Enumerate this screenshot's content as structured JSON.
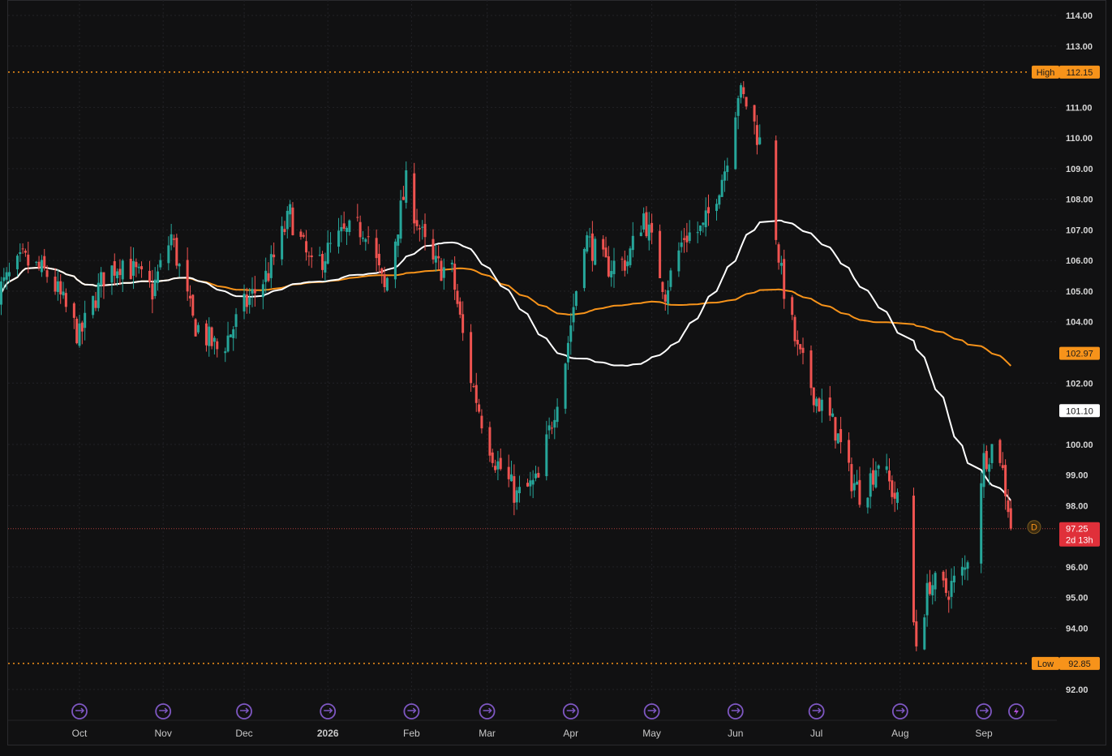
{
  "chart_data": {
    "type": "candlestick",
    "ylim": [
      91.6,
      114.2
    ],
    "y_ticks": [
      "114.00",
      "113.00",
      "111.00",
      "110.00",
      "109.00",
      "108.00",
      "107.00",
      "106.00",
      "105.00",
      "104.00",
      "102.00",
      "100.00",
      "99.00",
      "98.00",
      "96.00",
      "95.00",
      "94.00",
      "92.00"
    ],
    "x_labels": [
      {
        "label": "Oct",
        "date": "2025-10-01",
        "bold": false
      },
      {
        "label": "Nov",
        "date": "2025-11-01",
        "bold": false
      },
      {
        "label": "Dec",
        "date": "2025-12-01",
        "bold": false
      },
      {
        "label": "2026",
        "date": "2026-01-01",
        "bold": true
      },
      {
        "label": "Feb",
        "date": "2026-02-01",
        "bold": false
      },
      {
        "label": "Mar",
        "date": "2026-03-01",
        "bold": false
      },
      {
        "label": "Apr",
        "date": "2026-04-01",
        "bold": false
      },
      {
        "label": "May",
        "date": "2026-05-01",
        "bold": false
      },
      {
        "label": "Jun",
        "date": "2026-06-01",
        "bold": false
      },
      {
        "label": "Jul",
        "date": "2026-07-01",
        "bold": false
      },
      {
        "label": "Aug",
        "date": "2026-08-01",
        "bold": false
      },
      {
        "label": "Sep",
        "date": "2026-09-01",
        "bold": false
      }
    ],
    "x_range": [
      "2025-09-01",
      "2026-09-13"
    ],
    "high": {
      "label": "High",
      "value": "112.15"
    },
    "low": {
      "label": "Low",
      "value": "92.85"
    },
    "last_price": {
      "value": "97.25",
      "countdown": "2d 13h"
    },
    "moving_averages": [
      {
        "value": "102.97",
        "color": "#f7931a"
      },
      {
        "value": "101.10",
        "color": "#ffffff"
      }
    ],
    "anchor_prices": [
      {
        "date": "2025-09-01",
        "price": 105.0
      },
      {
        "date": "2025-09-10",
        "price": 106.0
      },
      {
        "date": "2025-09-20",
        "price": 105.5
      },
      {
        "date": "2025-10-01",
        "price": 103.5
      },
      {
        "date": "2025-10-10",
        "price": 105.5
      },
      {
        "date": "2025-10-17",
        "price": 106.0
      },
      {
        "date": "2025-10-28",
        "price": 105.0
      },
      {
        "date": "2025-11-04",
        "price": 106.8
      },
      {
        "date": "2025-11-12",
        "price": 104.0
      },
      {
        "date": "2025-11-22",
        "price": 103.0
      },
      {
        "date": "2025-12-01",
        "price": 104.5
      },
      {
        "date": "2025-12-10",
        "price": 105.6
      },
      {
        "date": "2025-12-18",
        "price": 107.5
      },
      {
        "date": "2025-12-26",
        "price": 105.7
      },
      {
        "date": "2026-01-06",
        "price": 106.8
      },
      {
        "date": "2026-01-15",
        "price": 107.1
      },
      {
        "date": "2026-01-22",
        "price": 105.0
      },
      {
        "date": "2026-01-30",
        "price": 108.5
      },
      {
        "date": "2026-02-08",
        "price": 105.9
      },
      {
        "date": "2026-02-16",
        "price": 105.6
      },
      {
        "date": "2026-02-22",
        "price": 102.5
      },
      {
        "date": "2026-02-28",
        "price": 100.5
      },
      {
        "date": "2026-03-04",
        "price": 99.5
      },
      {
        "date": "2026-03-12",
        "price": 98.3
      },
      {
        "date": "2026-03-20",
        "price": 98.8
      },
      {
        "date": "2026-03-30",
        "price": 102.8
      },
      {
        "date": "2026-04-06",
        "price": 106.8
      },
      {
        "date": "2026-04-14",
        "price": 105.8
      },
      {
        "date": "2026-04-22",
        "price": 106.0
      },
      {
        "date": "2026-04-28",
        "price": 107.5
      },
      {
        "date": "2026-05-06",
        "price": 105.0
      },
      {
        "date": "2026-05-13",
        "price": 106.8
      },
      {
        "date": "2026-05-20",
        "price": 107.0
      },
      {
        "date": "2026-05-28",
        "price": 109.0
      },
      {
        "date": "2026-06-02",
        "price": 111.5
      },
      {
        "date": "2026-06-06",
        "price": 111.0
      },
      {
        "date": "2026-06-13",
        "price": 109.0
      },
      {
        "date": "2026-06-18",
        "price": 105.5
      },
      {
        "date": "2026-06-24",
        "price": 103.0
      },
      {
        "date": "2026-07-01",
        "price": 101.5
      },
      {
        "date": "2026-07-08",
        "price": 100.5
      },
      {
        "date": "2026-07-13",
        "price": 99.0
      },
      {
        "date": "2026-07-18",
        "price": 98.3
      },
      {
        "date": "2026-07-24",
        "price": 99.5
      },
      {
        "date": "2026-07-31",
        "price": 98.1
      },
      {
        "date": "2026-08-07",
        "price": 93.5
      },
      {
        "date": "2026-08-12",
        "price": 95.5
      },
      {
        "date": "2026-08-18",
        "price": 95.2
      },
      {
        "date": "2026-08-25",
        "price": 95.9
      },
      {
        "date": "2026-09-01",
        "price": 99.5
      },
      {
        "date": "2026-09-06",
        "price": 100.2
      },
      {
        "date": "2026-09-10",
        "price": 98.0
      },
      {
        "date": "2026-09-12",
        "price": 97.25
      }
    ]
  },
  "event_markers": [
    {
      "date": "2025-10-01",
      "icon": "dividend-icon"
    },
    {
      "date": "2025-11-01",
      "icon": "dividend-icon"
    },
    {
      "date": "2025-12-01",
      "icon": "dividend-icon"
    },
    {
      "date": "2026-01-01",
      "icon": "dividend-icon"
    },
    {
      "date": "2026-02-01",
      "icon": "dividend-icon"
    },
    {
      "date": "2026-03-01",
      "icon": "dividend-icon"
    },
    {
      "date": "2026-04-01",
      "icon": "dividend-icon"
    },
    {
      "date": "2026-05-01",
      "icon": "dividend-icon"
    },
    {
      "date": "2026-06-01",
      "icon": "dividend-icon"
    },
    {
      "date": "2026-07-01",
      "icon": "dividend-icon"
    },
    {
      "date": "2026-08-01",
      "icon": "dividend-icon"
    },
    {
      "date": "2026-09-01",
      "icon": "dividend-icon"
    },
    {
      "date": "2026-09-13",
      "icon": "lightning-icon"
    }
  ],
  "badge_d": "D",
  "colors": {
    "up": "#26a69a",
    "down": "#ef5350",
    "ma_orange": "#f7931a",
    "ma_white": "#ffffff",
    "event": "#7e57c2"
  }
}
